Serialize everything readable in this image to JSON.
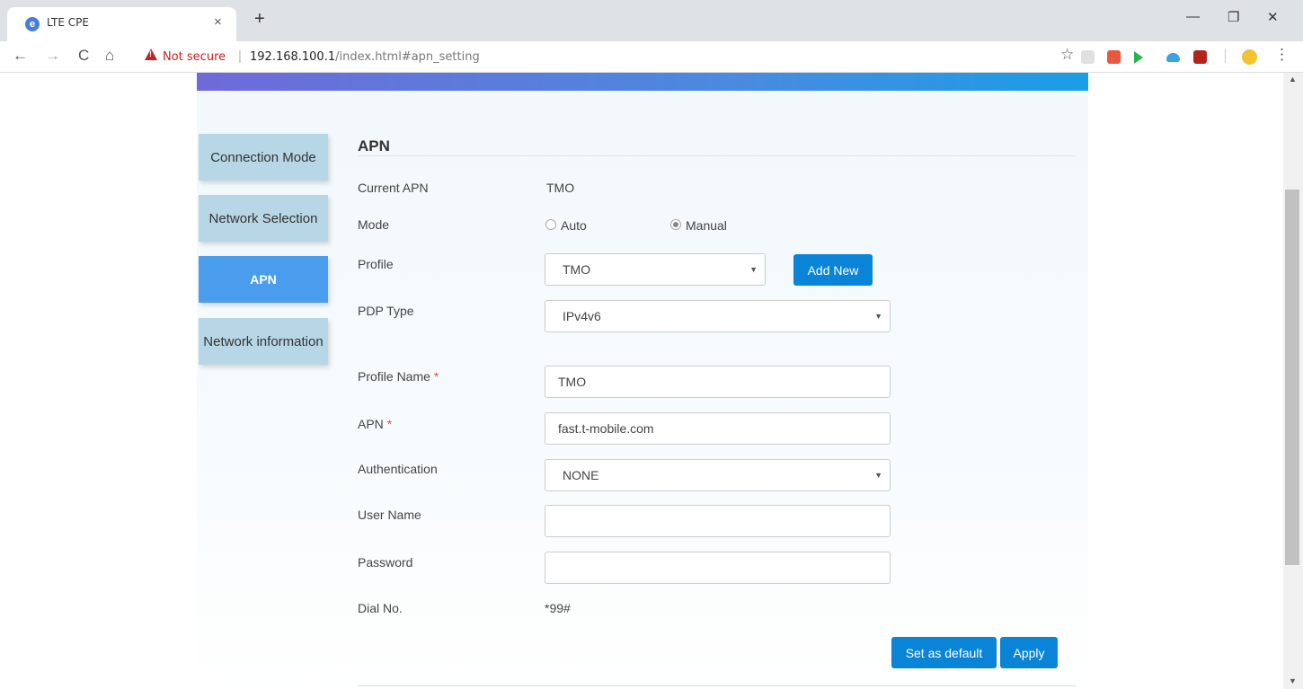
{
  "browser": {
    "tab_title": "LTE CPE",
    "tab_close": "×",
    "new_tab": "+",
    "minimize": "—",
    "restore": "❐",
    "close": "✕",
    "back": "←",
    "forward": "→",
    "reload": "C",
    "home": "⌂",
    "security_label": "Not secure",
    "url_host": "192.168.100.1",
    "url_path": "/index.html#apn_setting",
    "bookmark": "☆",
    "menu": "⋮"
  },
  "sidebar": {
    "items": [
      {
        "label": "Connection Mode",
        "active": false
      },
      {
        "label": "Network Selection",
        "active": false
      },
      {
        "label": "APN",
        "active": true
      },
      {
        "label": "Network information",
        "active": false
      }
    ]
  },
  "apn": {
    "title": "APN",
    "current_apn_label": "Current APN",
    "current_apn_value": "TMO",
    "mode_label": "Mode",
    "mode_options": [
      "Auto",
      "Manual"
    ],
    "mode_selected": "Manual",
    "profile_label": "Profile",
    "profile_value": "TMO",
    "add_new_label": "Add New",
    "pdp_type_label": "PDP Type",
    "pdp_type_value": "IPv4v6",
    "profile_name_label": "Profile Name",
    "profile_name_value": "TMO",
    "apn_label": "APN",
    "apn_value": "fast.t-mobile.com",
    "required_mark": "*",
    "authentication_label": "Authentication",
    "authentication_value": "NONE",
    "user_name_label": "User Name",
    "user_name_value": "",
    "password_label": "Password",
    "password_value": "",
    "dial_no_label": "Dial No.",
    "dial_no_value": "*99#",
    "set_default_label": "Set as default",
    "apply_label": "Apply"
  }
}
